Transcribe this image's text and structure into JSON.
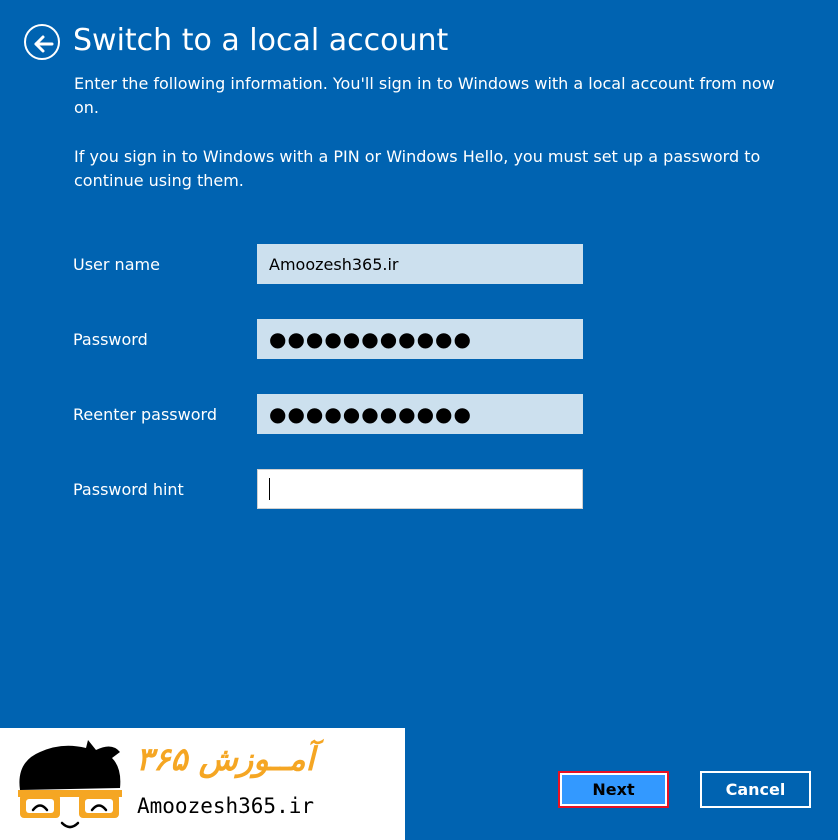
{
  "page": {
    "title": "Switch to a local account",
    "intro": "Enter the following information. You'll sign in to Windows with a local account from now on.",
    "note": "If you sign in to Windows with a PIN or Windows Hello, you must set up a password to continue using them."
  },
  "form": {
    "username": {
      "label": "User name",
      "value": "Amoozesh365.ir"
    },
    "password": {
      "label": "Password",
      "value": "●●●●●●●●●●●"
    },
    "reenter": {
      "label": "Reenter password",
      "value": "●●●●●●●●●●●"
    },
    "hint": {
      "label": "Password hint",
      "value": ""
    }
  },
  "buttons": {
    "next": "Next",
    "cancel": "Cancel"
  },
  "watermark": {
    "persian": "آمــوزش ۳۶۵",
    "latin": "Amoozesh365.ir"
  },
  "icons": {
    "back": "back-arrow-icon",
    "logo": "glasses-face-icon"
  },
  "colors": {
    "background": "#0063B1",
    "field": "#CCE0EE",
    "next_button": "#3399FF",
    "focus_border": "#E81123",
    "logo_accent": "#F5A623"
  }
}
